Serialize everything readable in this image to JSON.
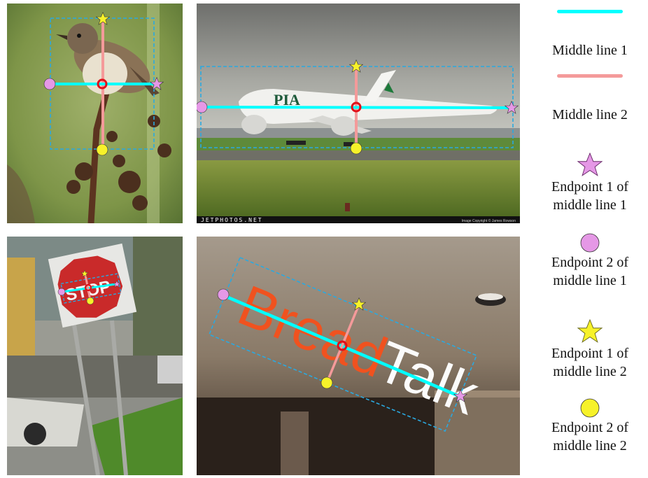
{
  "legend": {
    "middle_line_1": "Middle line 1",
    "middle_line_2": "Middle line 2",
    "endpoint1_line1": "Endpoint 1 of middle line 1",
    "endpoint2_line1": "Endpoint 2 of middle line 1",
    "endpoint1_line2": "Endpoint 1 of middle line 2",
    "endpoint2_line2": "Endpoint 2 of middle line 2"
  },
  "colors": {
    "middle_line_1": "#00ffff",
    "middle_line_2": "#f49a9a",
    "endpoint1_line1": "#e598e6",
    "endpoint2_line1": "#e598e6",
    "endpoint1_line2": "#f7f22a",
    "endpoint2_line2": "#f7f22a",
    "center_marker": "#e0101a",
    "bounding_box": "#2aa9e0"
  },
  "panels": {
    "plane": {
      "watermark": "JETPHOTOS.NET",
      "copyright": "Image Copyright © James Rowson",
      "tail_text": "PIA"
    },
    "stop": {
      "sign_text": "STOP"
    },
    "bread": {
      "sign_text_1": "Bread",
      "sign_text_2": "Talk"
    }
  },
  "icons": [
    "star-marker",
    "circle-marker"
  ]
}
